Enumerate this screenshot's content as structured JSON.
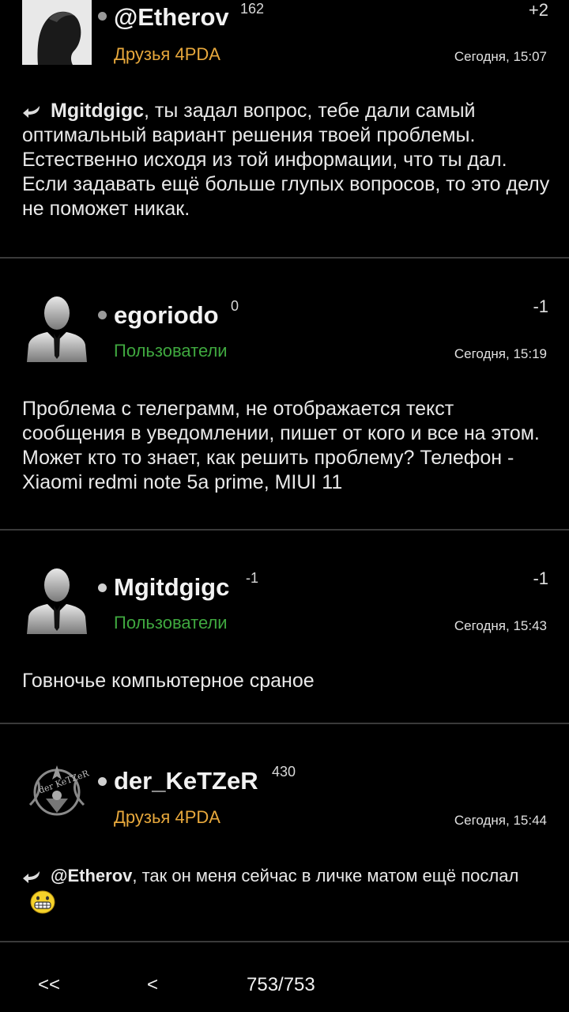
{
  "posts": [
    {
      "nick": "@Etherov",
      "rep": "162",
      "vote": "+2",
      "group": "Друзья 4PDA",
      "group_color": "#e7a83c",
      "time": "Сегодня, 15:07",
      "mention": "Mgitdgigc",
      "text": ", ты задал вопрос, тебе дали самый оптимальный вариант решения твоей проблемы. Естественно исходя из той информации, что ты дал. Если задавать ещё больше глупых вопросов, то это делу не поможет никак.",
      "avatar_icon": "user-photo-icon"
    },
    {
      "nick": "egoriodo",
      "rep": "0",
      "vote": "-1",
      "group": "Пользователи",
      "group_color": "#3fa83f",
      "time": "Сегодня, 15:19",
      "text": "Проблема с телеграмм, не отображается текст сообщения в уведомлении, пишет от кого и все на этом. Может кто то знает, как решить проблему? Телефон - Xiaomi redmi note 5a prime, MIUI 11",
      "avatar_icon": "default-user-icon"
    },
    {
      "nick": "Mgitdgigc",
      "rep": "-1",
      "vote": "-1",
      "group": "Пользователи",
      "group_color": "#3fa83f",
      "time": "Сегодня, 15:43",
      "text": "Говночье компьютерное сраное",
      "avatar_icon": "default-user-icon"
    },
    {
      "nick": "der_KeTZeR",
      "rep": "430",
      "vote": "",
      "group": "Друзья 4PDA",
      "group_color": "#e7a83c",
      "time": "Сегодня, 15:44",
      "mention": "@Etherov",
      "text": ", так он меня сейчас в личке матом ещё послал",
      "avatar_icon": "emblem-avatar-icon",
      "emoji": "grin-emoji-icon"
    }
  ],
  "nav": {
    "first": "<<",
    "prev": "<",
    "page": "753/753"
  }
}
